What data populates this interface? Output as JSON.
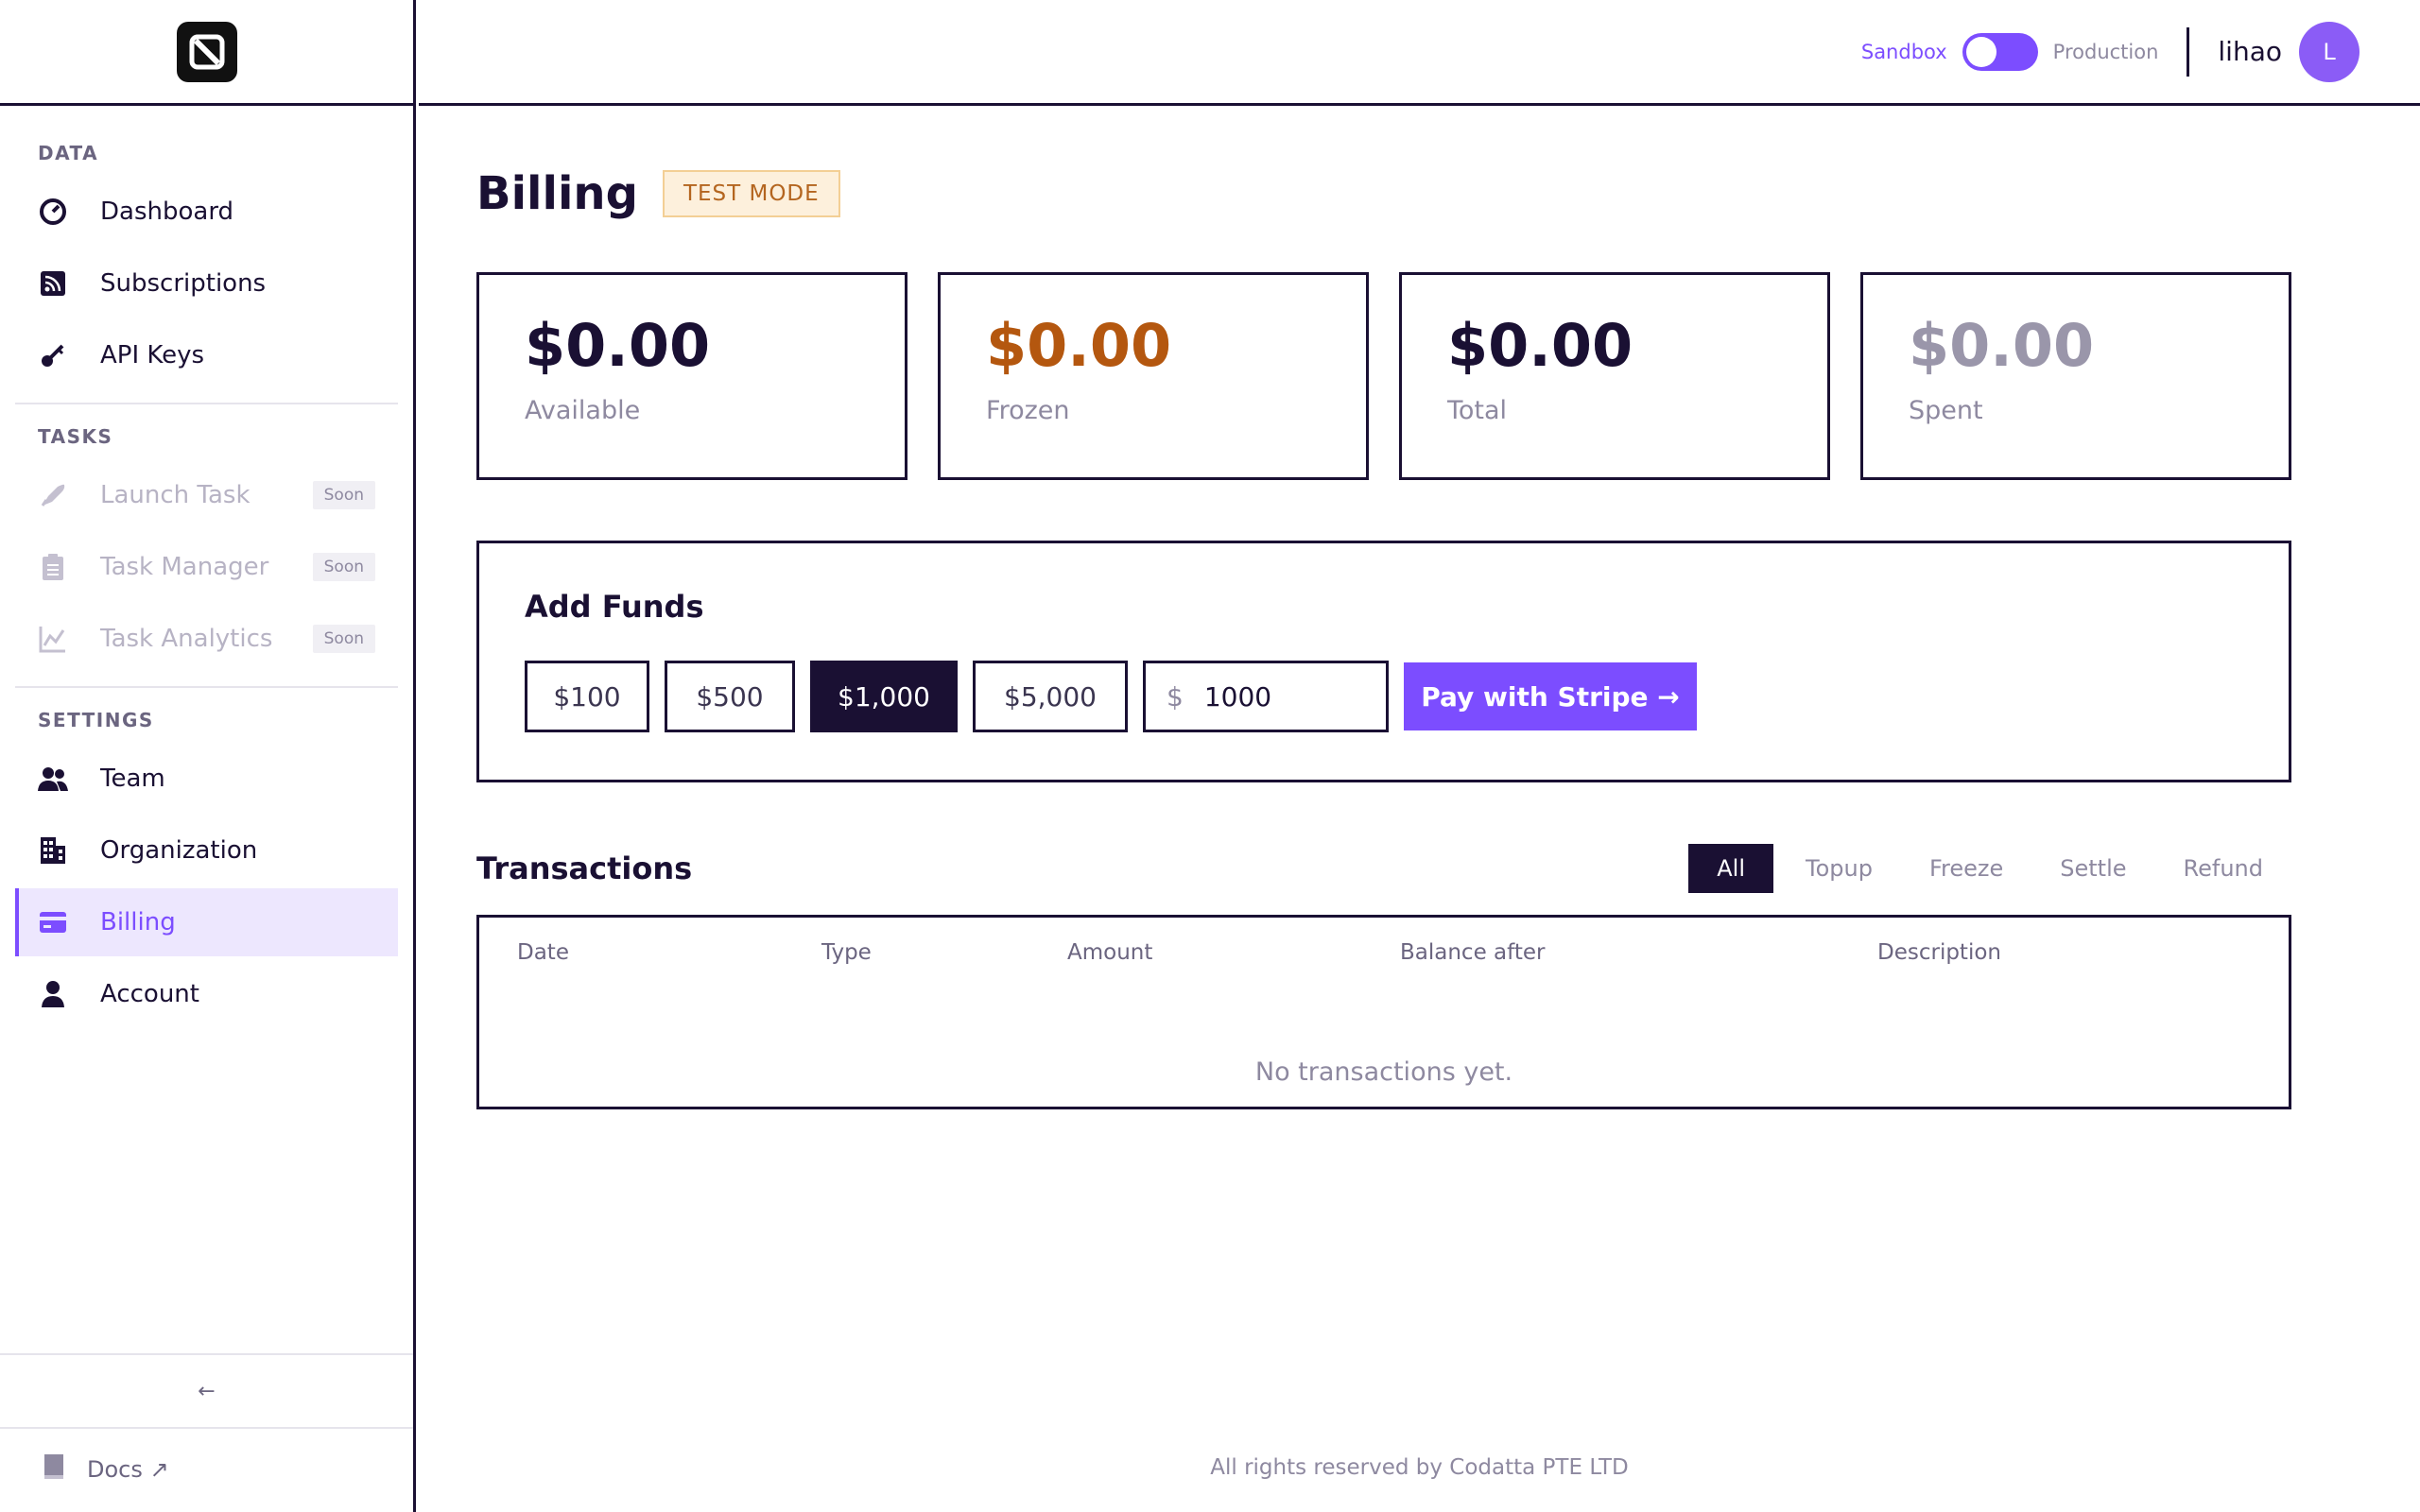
{
  "header": {
    "env_sandbox": "Sandbox",
    "env_production": "Production",
    "username": "lihao",
    "avatar_initial": "L"
  },
  "sidebar": {
    "sections": [
      {
        "label": "DATA"
      },
      {
        "label": "TASKS"
      },
      {
        "label": "SETTINGS"
      }
    ],
    "items": [
      {
        "label": "Dashboard",
        "icon": "dashboard-gauge-icon"
      },
      {
        "label": "Subscriptions",
        "icon": "rss-feed-icon"
      },
      {
        "label": "API Keys",
        "icon": "key-icon"
      },
      {
        "label": "Launch Task",
        "icon": "rocket-icon",
        "badge": "Soon"
      },
      {
        "label": "Task Manager",
        "icon": "clipboard-icon",
        "badge": "Soon"
      },
      {
        "label": "Task Analytics",
        "icon": "chart-icon",
        "badge": "Soon"
      },
      {
        "label": "Team",
        "icon": "users-icon"
      },
      {
        "label": "Organization",
        "icon": "building-icon"
      },
      {
        "label": "Billing",
        "icon": "credit-card-icon"
      },
      {
        "label": "Account",
        "icon": "user-icon"
      }
    ],
    "collapse_label": "←",
    "docs_label": "Docs ↗"
  },
  "page": {
    "title": "Billing",
    "badge": "TEST MODE"
  },
  "stats": [
    {
      "value": "$0.00",
      "label": "Available",
      "color": "#1a1033"
    },
    {
      "value": "$0.00",
      "label": "Frozen",
      "color": "#b4570f"
    },
    {
      "value": "$0.00",
      "label": "Total",
      "color": "#1a1033"
    },
    {
      "value": "$0.00",
      "label": "Spent",
      "color": "#9a96aa"
    }
  ],
  "funds": {
    "title": "Add Funds",
    "amounts": [
      "$100",
      "$500",
      "$1,000",
      "$5,000"
    ],
    "selected": "$1,000",
    "currency_symbol": "$",
    "custom_value": "1000",
    "pay_label": "Pay with Stripe →"
  },
  "transactions": {
    "title": "Transactions",
    "filters": [
      "All",
      "Topup",
      "Freeze",
      "Settle",
      "Refund"
    ],
    "active_filter": "All",
    "columns": [
      "Date",
      "Type",
      "Amount",
      "Balance after",
      "Description"
    ],
    "empty_text": "No transactions yet."
  },
  "footer": {
    "text": "All rights reserved by Codatta PTE LTD"
  },
  "colors": {
    "accent": "#7c4dff",
    "dark": "#1a1033",
    "frozen": "#b4570f",
    "badge_bg": "#fdf0dc"
  }
}
